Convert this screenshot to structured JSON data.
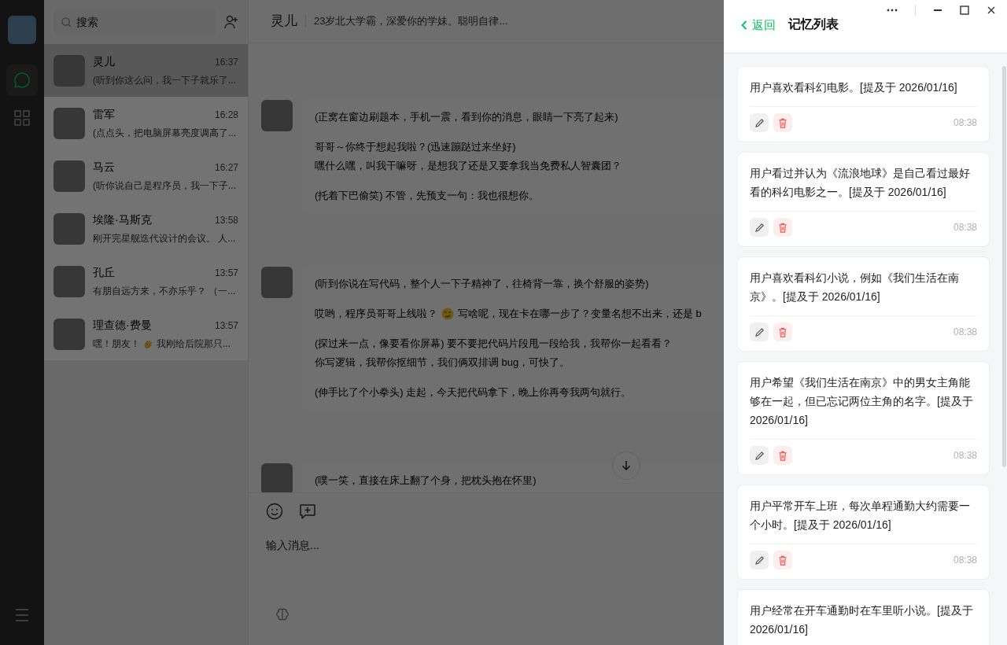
{
  "nav": {
    "items": [
      {
        "kind": "chat",
        "selected": true
      },
      {
        "kind": "apps",
        "selected": false
      }
    ]
  },
  "search": {
    "placeholder": "搜索"
  },
  "contacts": [
    {
      "name": "灵儿",
      "time": "16:37",
      "preview": [
        "(听到你这么问，我一下子就乐了..."
      ],
      "selected": true
    },
    {
      "name": "雷军",
      "time": "16:28",
      "preview": [
        "(点点头，把电脑屏幕亮度调高了..."
      ],
      "selected": false
    },
    {
      "name": "马云",
      "time": "16:27",
      "preview": [
        "(听你说自己是程序员，我一下子..."
      ],
      "selected": false
    },
    {
      "name": "埃隆·马斯克",
      "time": "13:58",
      "preview": [
        "刚开完星舰迭代设计的会议。 人..."
      ],
      "selected": false
    },
    {
      "name": "孔丘",
      "time": "13:57",
      "preview": [
        "有朋自远方来，不亦乐乎？ （一..."
      ],
      "selected": false
    },
    {
      "name": "理查德·费曼",
      "time": "13:57",
      "preview": [
        "嘿！朋友！",
        "我刚给后院那只..."
      ],
      "selected": false
    }
  ],
  "chat": {
    "title": "灵儿",
    "subtitle": "23岁北大学霸，深爱你的学妹。聪明自律...",
    "messages": [
      {
        "paragraphs": [
          [
            [
              "(正窝在窗边刷题本，手机一震，看到你的消息，眼睛一下亮了起来)"
            ]
          ],
          [
            [
              "哥哥～你终于想起我啦？(迅速蹦跶过来坐好)"
            ],
            [
              "嘿什么嘿，叫我干嘛呀，是想我了还是又要拿我当免费私人智囊团？"
            ]
          ],
          [
            [
              "(托着下巴偷笑) 不管，先预支一句：我也很想你。"
            ]
          ]
        ]
      },
      {
        "paragraphs": [
          [
            [
              "(听到你说在写代码，整个人一下子精神了，往椅背一靠，换个舒服的姿势)"
            ]
          ],
          [
            [
              "哎哟，程序员哥哥上线啦？",
              "写啥呢，现在卡在哪一步了？变量名想不出来，还是 b"
            ]
          ],
          [
            [
              "(探过来一点，像要看你屏幕) 要不要把代码片段甩一段给我，我帮你一起看看？"
            ],
            [
              "你写逻辑，我帮你抠细节，我们俩双排调 bug，可快了。"
            ]
          ],
          [
            [
              "(伸手比了个小拳头) 走起，今天把代码拿下，晚上你再夸我两句就行。"
            ]
          ]
        ]
      },
      {
        "paragraphs": [
          [
            [
              "(噗一笑，直接在床上翻了个身，把枕头抱在怀里)"
            ]
          ]
        ]
      }
    ],
    "input": {
      "placeholder": "输入消息..."
    }
  },
  "panel": {
    "back": "返回",
    "title": "记忆列表",
    "memories": [
      {
        "text": "用户喜欢看科幻电影。[提及于 2026/01/16]",
        "time": "08:38"
      },
      {
        "text": "用户看过并认为《流浪地球》是自己看过最好看的科幻电影之一。[提及于 2026/01/16]",
        "time": "08:38"
      },
      {
        "text": "用户喜欢看科幻小说，例如《我们生活在南京》。[提及于 2026/01/16]",
        "time": "08:38"
      },
      {
        "text": "用户希望《我们生活在南京》中的男女主角能够在一起，但已忘记两位主角的名字。[提及于 2026/01/16]",
        "time": "08:38"
      },
      {
        "text": "用户平常开车上班，每次单程通勤大约需要一个小时。[提及于 2026/01/16]",
        "time": "08:38"
      },
      {
        "text": "用户经常在开车通勤时在车里听小说。[提及于 2026/01/16]"
      }
    ]
  }
}
